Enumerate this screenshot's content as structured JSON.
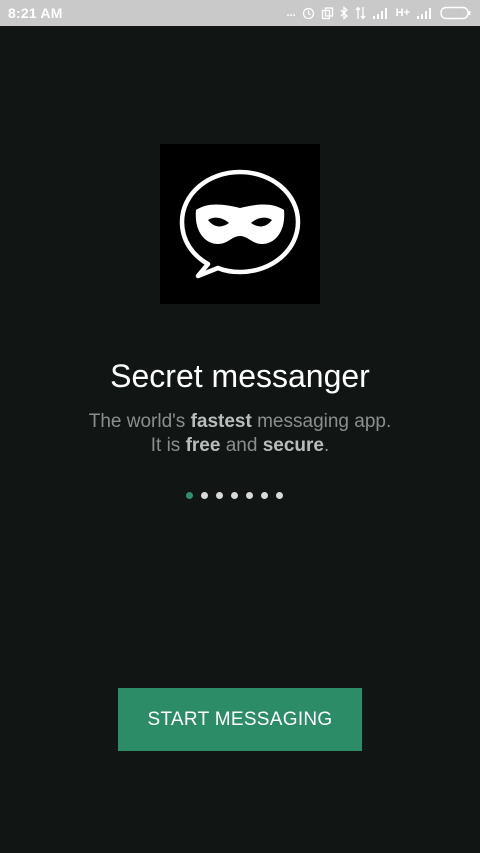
{
  "status_bar": {
    "time": "8:21 AM",
    "dots": "...",
    "network": "H+"
  },
  "intro": {
    "title": "Secret messanger",
    "line1_a": "The world's ",
    "line1_bold": "fastest",
    "line1_b": " messaging app.",
    "line2_a": "It is ",
    "line2_bold1": "free",
    "line2_mid": " and ",
    "line2_bold2": "secure",
    "line2_end": "."
  },
  "pager": {
    "total": 7,
    "active_index": 0
  },
  "button": {
    "label": "START MESSAGING"
  },
  "colors": {
    "accent": "#2c8c67",
    "background": "#111615"
  }
}
